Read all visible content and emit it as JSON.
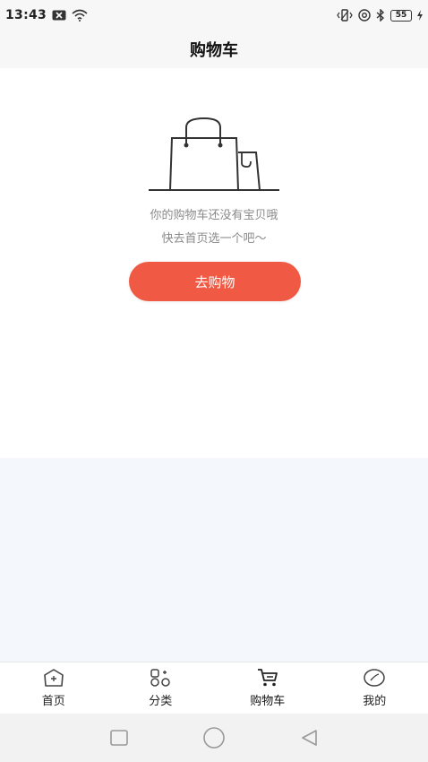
{
  "status_bar": {
    "time": "13:43",
    "battery": "55",
    "icons": [
      "notification-x-icon",
      "wifi-icon",
      "vibrate-icon",
      "at-icon",
      "bluetooth-icon",
      "battery-icon",
      "charging-icon"
    ]
  },
  "header": {
    "title": "购物车"
  },
  "empty_state": {
    "illustration": "shopping-bag-icon",
    "line1": "你的购物车还没有宝贝哦",
    "line2": "快去首页选一个吧～",
    "button_label": "去购物"
  },
  "colors": {
    "accent": "#f05a44",
    "page_bg": "#f4f7fc",
    "content_bg": "#ffffff"
  },
  "tabs": [
    {
      "label": "首页",
      "icon": "home-icon",
      "active": false
    },
    {
      "label": "分类",
      "icon": "category-icon",
      "active": false
    },
    {
      "label": "购物车",
      "icon": "cart-icon",
      "active": true
    },
    {
      "label": "我的",
      "icon": "profile-icon",
      "active": false
    }
  ],
  "system_nav": [
    "recent-apps-icon",
    "home-circle-icon",
    "back-icon"
  ]
}
